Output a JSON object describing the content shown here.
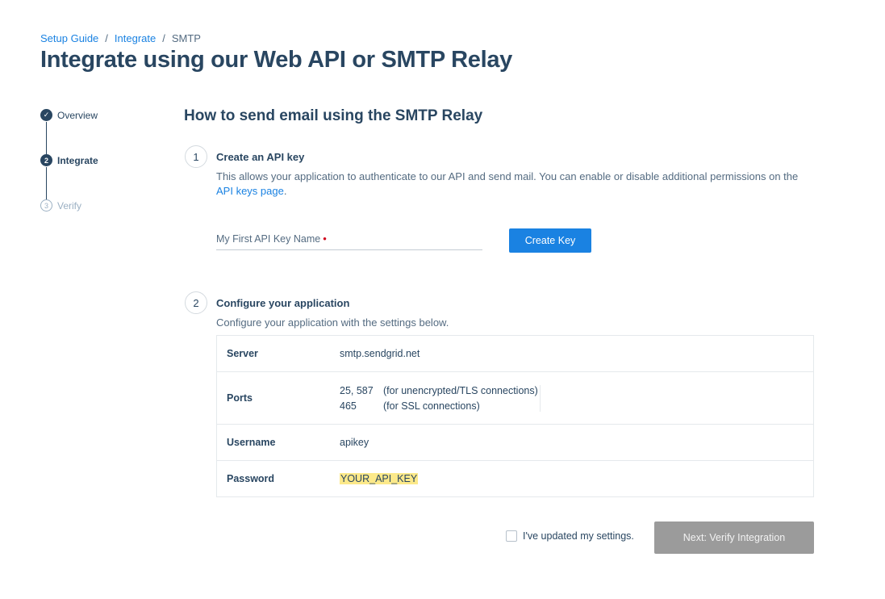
{
  "breadcrumb": {
    "items": [
      "Setup Guide",
      "Integrate",
      "SMTP"
    ],
    "separator": "/"
  },
  "page_title": "Integrate using our Web API or SMTP Relay",
  "stepper": {
    "steps": [
      {
        "label": "Overview",
        "marker": "✓",
        "state": "done"
      },
      {
        "label": "Integrate",
        "marker": "2",
        "state": "active"
      },
      {
        "label": "Verify",
        "marker": "3",
        "state": "todo"
      }
    ]
  },
  "section_title": "How to send email using the SMTP Relay",
  "step1": {
    "number": "1",
    "heading": "Create an API key",
    "desc_before": "This allows your application to authenticate to our API and send mail. You can enable or disable additional permissions on the ",
    "desc_link": "API keys page",
    "desc_after": ".",
    "input_label": "My First API Key Name",
    "required_marker": "•",
    "button": "Create Key"
  },
  "step2": {
    "number": "2",
    "heading": "Configure your application",
    "desc": "Configure your application with the settings below.",
    "settings": {
      "server": {
        "key": "Server",
        "value": "smtp.sendgrid.net"
      },
      "ports": {
        "key": "Ports",
        "lines": [
          {
            "port": "25, 587",
            "note": "(for unencrypted/TLS connections)"
          },
          {
            "port": "465",
            "note": "(for SSL connections)"
          }
        ]
      },
      "username": {
        "key": "Username",
        "value": "apikey"
      },
      "password": {
        "key": "Password",
        "value": "YOUR_API_KEY"
      }
    }
  },
  "footer": {
    "checkbox_label": "I've updated my settings.",
    "checkbox_checked": false,
    "next_button": "Next: Verify Integration"
  },
  "colors": {
    "primary_blue": "#1a82e2",
    "text_navy": "#294661",
    "highlight_yellow": "#fce98a",
    "disabled_gray": "#9b9b9b"
  }
}
